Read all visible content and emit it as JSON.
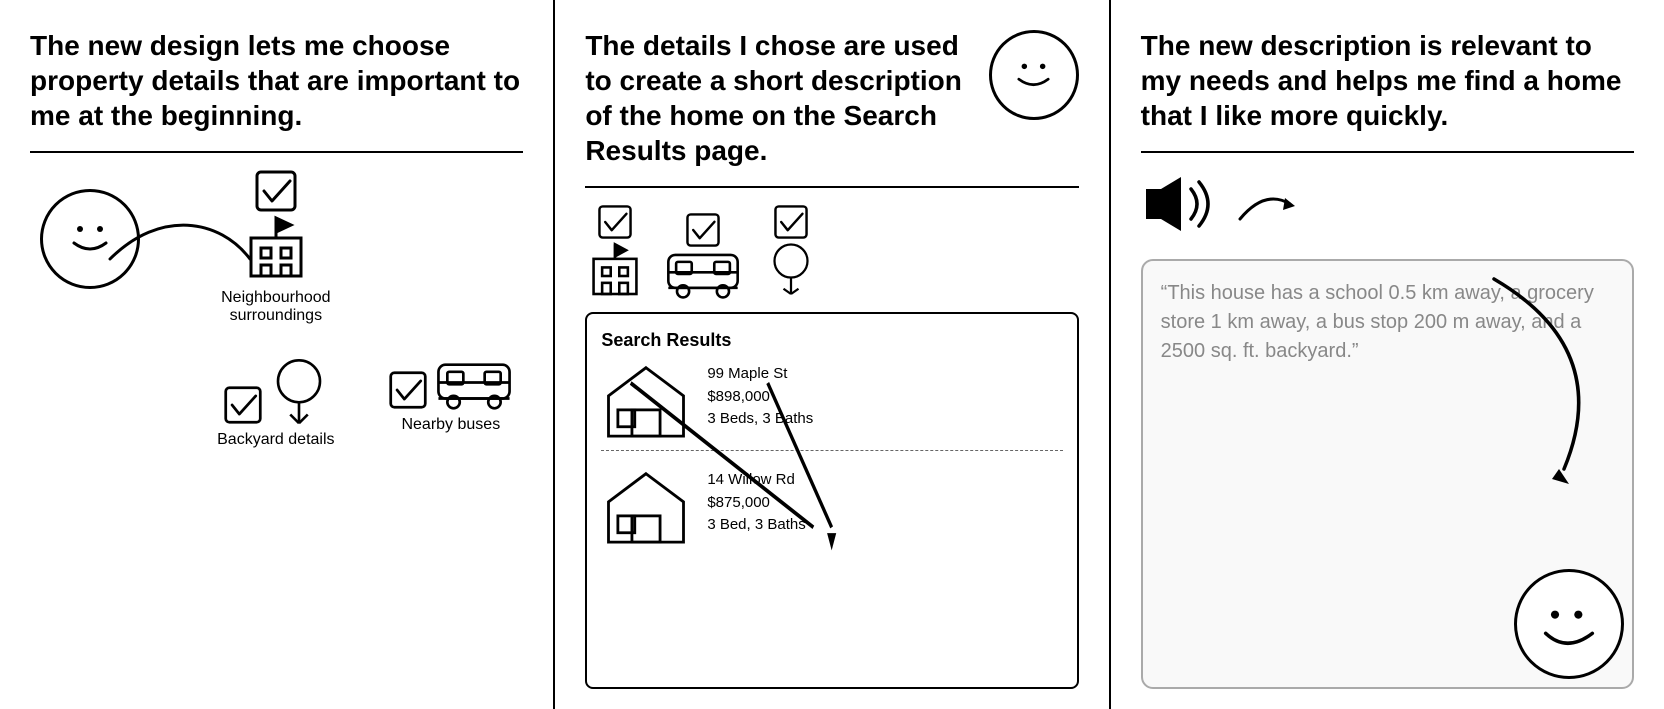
{
  "panel1": {
    "title": "The new design lets me choose property details that are important to me at the beginning.",
    "items": [
      {
        "label": "Neighbourhood surroundings",
        "icon": "building"
      },
      {
        "label": "Backyard details",
        "icon": "tree"
      },
      {
        "label": "Nearby buses",
        "icon": "bus"
      }
    ]
  },
  "panel2": {
    "title": "The details I chose are used to create a short description of the home on the Search Results page.",
    "search_results": {
      "heading": "Search Results",
      "listings": [
        {
          "address": "99 Maple St",
          "price": "$898,000",
          "details": "3 Beds, 3 Baths"
        },
        {
          "address": "14 Willow Rd",
          "price": "$875,000",
          "details": "3 Bed, 3 Baths"
        }
      ]
    }
  },
  "panel3": {
    "title": "The new description is relevant to my needs and helps me find a home that I like more quickly.",
    "speech_text": "“This house has a school 0.5 km away, a grocery store 1 km away, a bus stop 200 m away, and a 2500 sq. ft. backyard.”"
  }
}
